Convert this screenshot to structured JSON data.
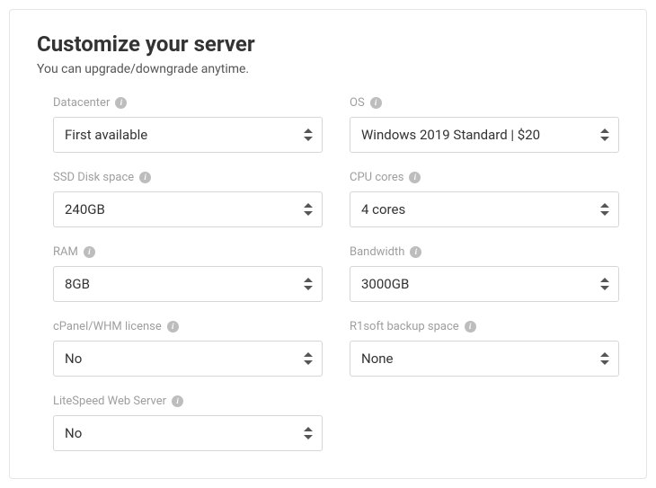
{
  "header": {
    "title": "Customize your server",
    "subtitle": "You can upgrade/downgrade anytime."
  },
  "fields": {
    "datacenter": {
      "label": "Datacenter",
      "value": "First available"
    },
    "os": {
      "label": "OS",
      "value": "Windows 2019 Standard | $20"
    },
    "disk": {
      "label": "SSD Disk space",
      "value": "240GB"
    },
    "cpu": {
      "label": "CPU cores",
      "value": "4 cores"
    },
    "ram": {
      "label": "RAM",
      "value": "8GB"
    },
    "bandwidth": {
      "label": "Bandwidth",
      "value": "3000GB"
    },
    "cpanel": {
      "label": "cPanel/WHM license",
      "value": "No"
    },
    "backup": {
      "label": "R1soft backup space",
      "value": "None"
    },
    "litespeed": {
      "label": "LiteSpeed Web Server",
      "value": "No"
    }
  }
}
